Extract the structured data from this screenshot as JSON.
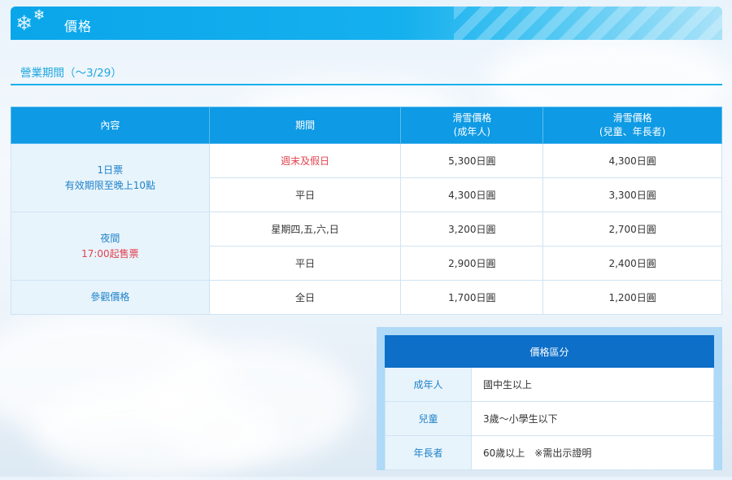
{
  "header": {
    "title": "價格",
    "icon": "snowflake-icon"
  },
  "subheading": "營業期間（〜3/29）",
  "price_table": {
    "headers": {
      "content": "內容",
      "period": "期間",
      "adult_line1": "滑雪價格",
      "adult_line2": "(成年人)",
      "child_line1": "滑雪價格",
      "child_line2": "(兒童、年長者)"
    },
    "day_ticket": {
      "label_line1": "1日票",
      "label_line2": "有效期限至晚上10點"
    },
    "night": {
      "label_line1": "夜間",
      "label_line2": "17:00起售票"
    },
    "sightseeing": {
      "label": "參觀價格"
    },
    "rows": [
      {
        "period": "週末及假日",
        "adult": "5,300日圓",
        "child": "4,300日圓"
      },
      {
        "period": "平日",
        "adult": "4,300日圓",
        "child": "3,300日圓"
      },
      {
        "period": "星期四,五,六,日",
        "adult": "3,200日圓",
        "child": "2,700日圓"
      },
      {
        "period": "平日",
        "adult": "2,900日圓",
        "child": "2,400日圓"
      },
      {
        "period": "全日",
        "adult": "1,700日圓",
        "child": "1,200日圓"
      }
    ]
  },
  "classification": {
    "title": "價格區分",
    "rows": [
      {
        "label": "成年人",
        "value": "國中生以上"
      },
      {
        "label": "兒童",
        "value": "3歲〜小學生以下"
      },
      {
        "label": "年長者",
        "value": "60歲以上　※需出示證明"
      }
    ]
  },
  "colors": {
    "accent": "#0e9ae4",
    "header_dark": "#0d6fc8",
    "label_bg": "#e8f4fc",
    "label_text": "#1f82c9",
    "highlight_red": "#e2414d"
  }
}
